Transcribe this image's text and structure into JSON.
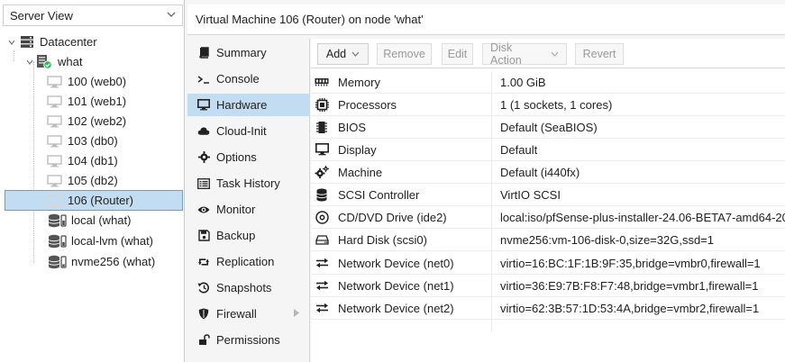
{
  "view_selector": {
    "value": "Server View"
  },
  "tree": {
    "datacenter": "Datacenter",
    "node": "what",
    "vms": [
      {
        "label": "100 (web0)"
      },
      {
        "label": "101 (web1)"
      },
      {
        "label": "102 (web2)"
      },
      {
        "label": "103 (db0)"
      },
      {
        "label": "104 (db1)"
      },
      {
        "label": "105 (db2)"
      },
      {
        "label": "106 (Router)"
      }
    ],
    "storages": [
      {
        "label": "local (what)"
      },
      {
        "label": "local-lvm (what)"
      },
      {
        "label": "nvme256 (what)"
      }
    ]
  },
  "header": {
    "title": "Virtual Machine 106 (Router) on node 'what'"
  },
  "nav": [
    {
      "label": "Summary",
      "icon": "book-icon"
    },
    {
      "label": "Console",
      "icon": "terminal-icon"
    },
    {
      "label": "Hardware",
      "icon": "desktop-icon",
      "active": true
    },
    {
      "label": "Cloud-Init",
      "icon": "cloud-icon"
    },
    {
      "label": "Options",
      "icon": "gear-icon"
    },
    {
      "label": "Task History",
      "icon": "list-icon"
    },
    {
      "label": "Monitor",
      "icon": "eye-icon"
    },
    {
      "label": "Backup",
      "icon": "floppy-icon"
    },
    {
      "label": "Replication",
      "icon": "retweet-icon"
    },
    {
      "label": "Snapshots",
      "icon": "history-icon"
    },
    {
      "label": "Firewall",
      "icon": "shield-icon"
    },
    {
      "label": "Permissions",
      "icon": "unlock-icon"
    }
  ],
  "toolbar": {
    "add": "Add",
    "remove": "Remove",
    "edit": "Edit",
    "disk_action": "Disk Action",
    "revert": "Revert"
  },
  "hardware": [
    {
      "key": "Memory",
      "value": "1.00 GiB",
      "icon": "memory-icon"
    },
    {
      "key": "Processors",
      "value": "1 (1 sockets, 1 cores)",
      "icon": "cpu-icon"
    },
    {
      "key": "BIOS",
      "value": "Default (SeaBIOS)",
      "icon": "microchip-icon"
    },
    {
      "key": "Display",
      "value": "Default",
      "icon": "monitor-icon"
    },
    {
      "key": "Machine",
      "value": "Default (i440fx)",
      "icon": "cogs-icon"
    },
    {
      "key": "SCSI Controller",
      "value": "VirtIO SCSI",
      "icon": "database-icon"
    },
    {
      "key": "CD/DVD Drive (ide2)",
      "value": "local:iso/pfSense-plus-installer-24.06-BETA7-amd64-20",
      "icon": "cdrom-icon"
    },
    {
      "key": "Hard Disk (scsi0)",
      "value": "nvme256:vm-106-disk-0,size=32G,ssd=1",
      "icon": "hdd-icon"
    },
    {
      "key": "Network Device (net0)",
      "value": "virtio=16:BC:1F:1B:9F:35,bridge=vmbr0,firewall=1",
      "icon": "exchange-icon"
    },
    {
      "key": "Network Device (net1)",
      "value": "virtio=36:E9:7B:F8:F7:48,bridge=vmbr1,firewall=1",
      "icon": "exchange-icon"
    },
    {
      "key": "Network Device (net2)",
      "value": "virtio=62:3B:57:1D:53:4A,bridge=vmbr2,firewall=1",
      "icon": "exchange-icon"
    }
  ],
  "colors": {
    "selection": "#c2ddf2",
    "status_ok": "#21bf4b",
    "accent": "#6b9ccf"
  }
}
